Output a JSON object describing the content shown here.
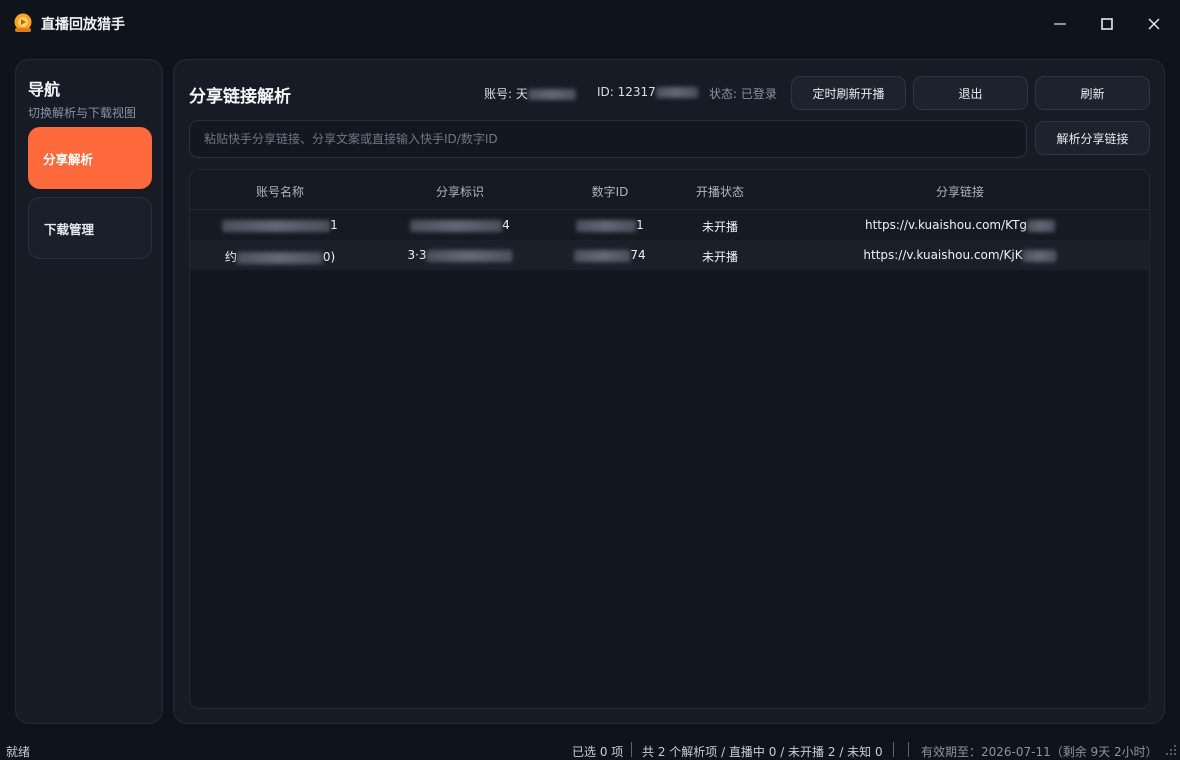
{
  "window": {
    "title": "直播回放猎手"
  },
  "sidebar": {
    "title": "导航",
    "subtitle": "切换解析与下载视图",
    "items": [
      {
        "label": "分享解析",
        "active": true
      },
      {
        "label": "下载管理",
        "active": false
      }
    ]
  },
  "header": {
    "title": "分享链接解析",
    "account_label": "账号: 天",
    "id_label": "ID: 12317",
    "status_label": "状态: 已登录",
    "schedule_button": "定时刷新开播",
    "logout_button": "退出",
    "refresh_button": "刷新"
  },
  "search": {
    "placeholder": "粘贴快手分享链接、分享文案或直接输入快手ID/数字ID",
    "value": "",
    "parse_button": "解析分享链接"
  },
  "table": {
    "columns": [
      "账号名称",
      "分享标识",
      "数字ID",
      "开播状态",
      "分享链接"
    ],
    "rows": [
      {
        "name_start": "",
        "name_end": "1",
        "share_id_start": "",
        "share_id_end": "4",
        "digit_id_end": "1",
        "status": "未开播",
        "link": "https://v.kuaishou.com/KTg"
      },
      {
        "name_start": "约",
        "name_end": "0)",
        "share_id_start": "3·3",
        "share_id_end": "",
        "digit_id_end": "74",
        "status": "未开播",
        "link": "https://v.kuaishou.com/KjK"
      }
    ]
  },
  "statusbar": {
    "ready": "就绪",
    "selected": "已选 0 项",
    "summary": "共 2 个解析项 / 直播中 0 / 未开播 2 / 未知 0",
    "expiry": "有效期至：2026-07-11（剩余 9天 2小时）"
  },
  "colors": {
    "accent": "#ff6a3d",
    "background": "#0f131b",
    "panel": "#161b25"
  }
}
